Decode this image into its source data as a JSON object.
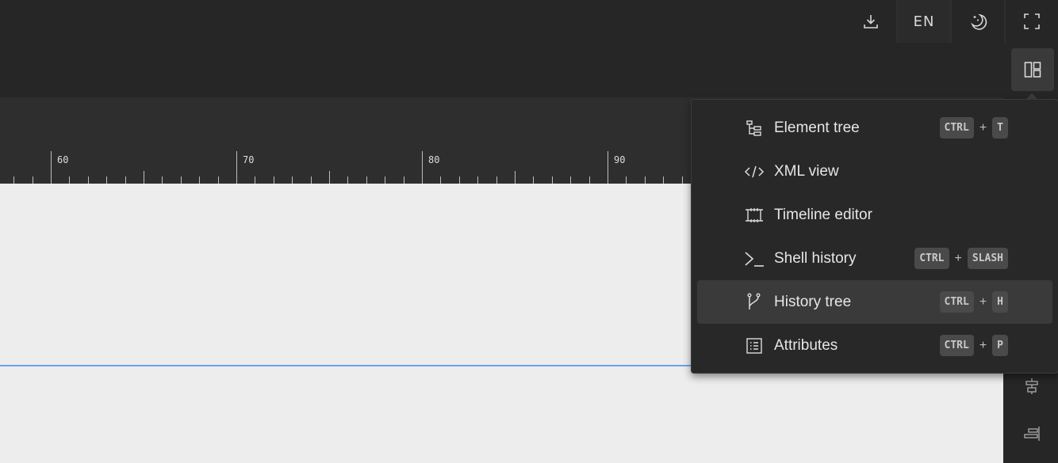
{
  "toolbar": {
    "language": "EN"
  },
  "ruler": {
    "labels": [
      "60",
      "70",
      "80",
      "90"
    ]
  },
  "menu": {
    "items": [
      {
        "label": "Element tree",
        "icon": "element-tree-icon",
        "keys": [
          "CTRL",
          "T"
        ]
      },
      {
        "label": "XML view",
        "icon": "code-icon",
        "keys": []
      },
      {
        "label": "Timeline editor",
        "icon": "timeline-icon",
        "keys": []
      },
      {
        "label": "Shell history",
        "icon": "terminal-icon",
        "keys": [
          "CTRL",
          "SLASH"
        ]
      },
      {
        "label": "History tree",
        "icon": "branch-icon",
        "keys": [
          "CTRL",
          "H"
        ],
        "active": true
      },
      {
        "label": "Attributes",
        "icon": "list-icon",
        "keys": [
          "CTRL",
          "P"
        ]
      }
    ],
    "plus": "+"
  },
  "colors": {
    "guide": "#6aa2ee",
    "menu_bg": "#282828",
    "topbar_bg": "#262626"
  }
}
